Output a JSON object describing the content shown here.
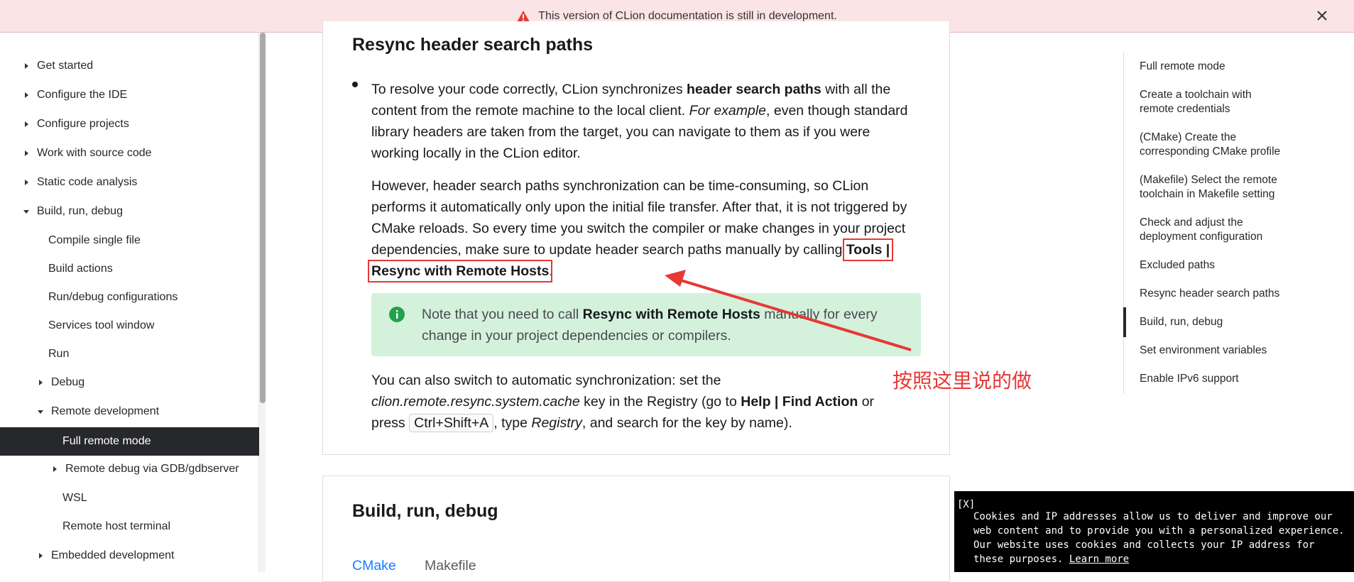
{
  "banner": {
    "text": "This version of CLion documentation is still in development."
  },
  "sidebar": {
    "items": [
      {
        "label": "Get started"
      },
      {
        "label": "Configure the IDE"
      },
      {
        "label": "Configure projects"
      },
      {
        "label": "Work with source code"
      },
      {
        "label": "Static code analysis"
      },
      {
        "label": "Build, run, debug"
      },
      {
        "label": "Compile single file"
      },
      {
        "label": "Build actions"
      },
      {
        "label": "Run/debug configurations"
      },
      {
        "label": "Services tool window"
      },
      {
        "label": "Run"
      },
      {
        "label": "Debug"
      },
      {
        "label": "Remote development"
      },
      {
        "label": "Full remote mode"
      },
      {
        "label": "Remote debug via GDB/gdbserver"
      },
      {
        "label": "WSL"
      },
      {
        "label": "Remote host terminal"
      },
      {
        "label": "Embedded development"
      }
    ]
  },
  "article": {
    "section1_title": "Resync header search paths",
    "p1": {
      "a": "To resolve your code correctly, CLion synchronizes ",
      "b": "header search paths",
      "c": " with all the content from the remote machine to the local client. ",
      "d": "For example",
      "e": ", even though standard library headers are taken from the target, you can navigate to them as if you were working locally in the CLion editor."
    },
    "p2": {
      "a": "However, header search paths synchronization can be time-consuming, so CLion performs it automatically only upon the initial file transfer. After that, it is not triggered by CMake reloads. So every time you switch the compiler or make changes in your project dependencies, make sure to update header search paths manually by calling ",
      "b": "Tools | Resync with Remote Hosts",
      "c": "."
    },
    "note": {
      "a": "Note that you need to call ",
      "b": "Resync with Remote Hosts",
      "c": " manually for every change in your project dependencies or compilers."
    },
    "p3": {
      "a": "You can also switch to automatic synchronization: set the ",
      "b": "clion.remote.resync.system.cache",
      "c": " key in the Registry (go to ",
      "d": "Help | Find Action",
      "e": " or press ",
      "f": "Ctrl+Shift+A",
      "g": ", type ",
      "h": "Registry",
      "i": ", and search for the key by name)."
    },
    "annotation": "按照这里说的做",
    "section2_title": "Build, run, debug",
    "tabs": [
      "CMake",
      "Makefile"
    ]
  },
  "toc": {
    "items": [
      {
        "label": "Full remote mode"
      },
      {
        "label": "Create a toolchain with remote credentials"
      },
      {
        "label": "(CMake) Create the corresponding CMake profile"
      },
      {
        "label": "(Makefile) Select the remote toolchain in Makefile setting"
      },
      {
        "label": "Check and adjust the deployment configuration"
      },
      {
        "label": "Excluded paths"
      },
      {
        "label": "Resync header search paths"
      },
      {
        "label": "Build, run, debug"
      },
      {
        "label": "Set environment variables"
      },
      {
        "label": "Enable IPv6 support"
      }
    ]
  },
  "cookie": {
    "close": "[X]",
    "text": "Cookies and IP addresses allow us to deliver and improve our web content and to provide you with a personalized experience. Our website uses cookies and collects your IP address for these purposes. ",
    "link": "Learn more"
  },
  "colors": {
    "accent": "#167dff",
    "active_nav": "#27282c",
    "note_bg": "#d4f1dc",
    "annotation_red": "#e53935"
  }
}
